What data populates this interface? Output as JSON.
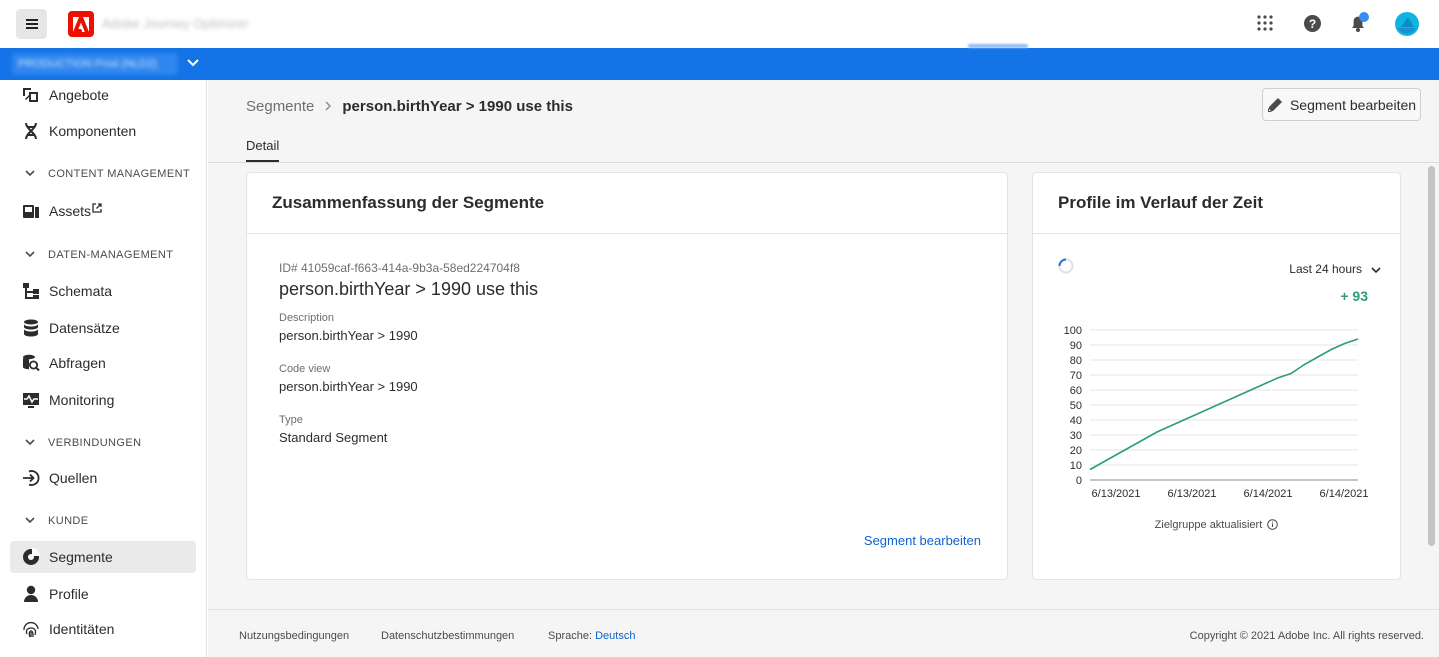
{
  "app": {
    "title": "Adobe Journey Optimizer",
    "org_selector": "PRODUCTION   Prod (NLD2)"
  },
  "sidebar": {
    "items_top": [
      {
        "label": "Angebote"
      },
      {
        "label": "Komponenten"
      }
    ],
    "sections": [
      {
        "title": "CONTENT MANAGEMENT",
        "items": [
          {
            "label": "Assets"
          }
        ]
      },
      {
        "title": "DATEN-MANAGEMENT",
        "items": [
          {
            "label": "Schemata"
          },
          {
            "label": "Datensätze"
          },
          {
            "label": "Abfragen"
          },
          {
            "label": "Monitoring"
          }
        ]
      },
      {
        "title": "VERBINDUNGEN",
        "items": [
          {
            "label": "Quellen"
          }
        ]
      },
      {
        "title": "KUNDE",
        "items": [
          {
            "label": "Segmente"
          },
          {
            "label": "Profile"
          },
          {
            "label": "Identitäten"
          }
        ]
      }
    ]
  },
  "breadcrumb": {
    "parent": "Segmente",
    "current": "person.birthYear > 1990 use this"
  },
  "header": {
    "edit_button": "Segment bearbeiten"
  },
  "tabs": [
    {
      "label": "Detail"
    }
  ],
  "summary": {
    "title": "Zusammenfassung der Segmente",
    "id": "ID# 41059caf-f663-414a-9b3a-58ed224704f8",
    "name": "person.birthYear > 1990 use this",
    "description_label": "Description",
    "description": "person.birthYear > 1990",
    "code_label": "Code view",
    "code": "person.birthYear > 1990",
    "type_label": "Type",
    "type": "Standard Segment",
    "edit_link": "Segment bearbeiten"
  },
  "profiles": {
    "title": "Profile im Verlauf der Zeit",
    "range": "Last 24 hours",
    "delta": "+ 93",
    "caption": "Zielgruppe aktualisiert"
  },
  "chart_data": {
    "type": "line",
    "y_ticks": [
      0,
      10,
      20,
      30,
      40,
      50,
      60,
      70,
      80,
      90,
      100
    ],
    "ylim": [
      0,
      100
    ],
    "x_ticks": [
      "6/13/2021",
      "6/13/2021",
      "6/14/2021",
      "6/14/2021"
    ],
    "series": [
      {
        "values": [
          7,
          12,
          17,
          22,
          27,
          32,
          36,
          40,
          44,
          48,
          52,
          56,
          60,
          64,
          68,
          71,
          77,
          82,
          87,
          91,
          94
        ]
      }
    ],
    "line_color": "#2d9d78",
    "grid": true
  },
  "footer": {
    "terms": "Nutzungsbedingungen",
    "privacy": "Datenschutzbestimmungen",
    "lang_label": "Sprache:",
    "lang": "Deutsch",
    "copyright": "Copyright ©  2021 Adobe Inc.  All rights reserved."
  }
}
